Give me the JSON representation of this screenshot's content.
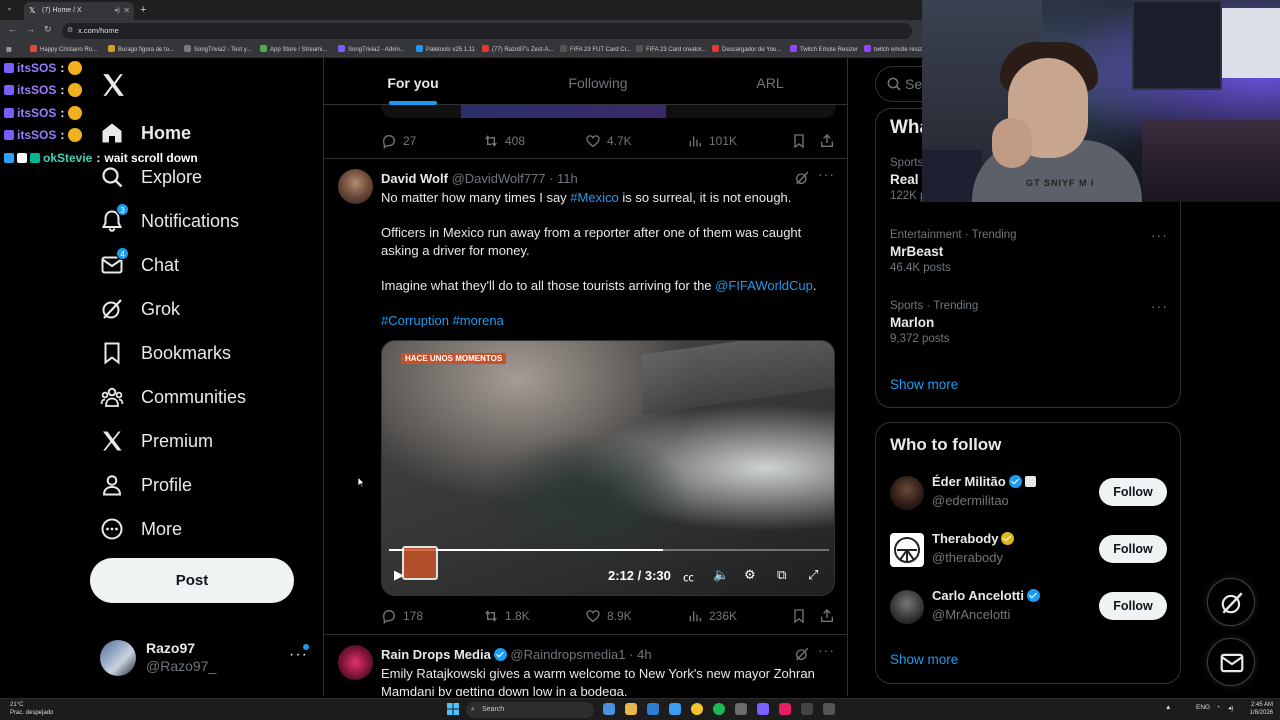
{
  "browser": {
    "tab_title": "(7) Home / X",
    "url": "x.com/home",
    "new_tab": "+",
    "bookmarks": [
      {
        "label": "Happy Cristiano Ro...",
        "color": "#e04a3a"
      },
      {
        "label": "Burago figura de to...",
        "color": "#d8a020"
      },
      {
        "label": "SongTrivia2 - Test y...",
        "color": "#7a7a7a"
      },
      {
        "label": "App Store / Streami...",
        "color": "#4caf50"
      },
      {
        "label": "SongTrivia2 - Advin...",
        "color": "#7a5cff"
      },
      {
        "label": "Paletools v25.1.11",
        "color": "#2196f3"
      },
      {
        "label": "(77) Razo97's Zest-A...",
        "color": "#e53935"
      },
      {
        "label": "FIFA 23 FUT Card Cr...",
        "color": "#555555"
      },
      {
        "label": "FIFA 23 Card creator...",
        "color": "#555555"
      },
      {
        "label": "Descargador de You...",
        "color": "#e53935"
      },
      {
        "label": "Twitch Emote Resizer",
        "color": "#9146ff"
      },
      {
        "label": "twitch emote resiz...",
        "color": "#9146ff"
      }
    ]
  },
  "chat": [
    {
      "user": "itsSOS",
      "msg": ""
    },
    {
      "user": "itsSOS",
      "msg": ""
    },
    {
      "user": "itsSOS",
      "msg": ""
    },
    {
      "user": "itsSOS",
      "msg": ""
    },
    {
      "user": "okStevie",
      "msg": "wait scroll down"
    }
  ],
  "nav": {
    "items": [
      {
        "label": "Home",
        "icon": "home-icon"
      },
      {
        "label": "Explore",
        "icon": "search-icon"
      },
      {
        "label": "Notifications",
        "icon": "bell-icon",
        "badge": "3"
      },
      {
        "label": "Chat",
        "icon": "mail-icon",
        "badge": "4"
      },
      {
        "label": "Grok",
        "icon": "grok-icon"
      },
      {
        "label": "Bookmarks",
        "icon": "bookmark-icon"
      },
      {
        "label": "Communities",
        "icon": "people-icon"
      },
      {
        "label": "Premium",
        "icon": "x-logo-icon"
      },
      {
        "label": "Profile",
        "icon": "person-icon"
      },
      {
        "label": "More",
        "icon": "more-circle-icon"
      }
    ],
    "post_label": "Post"
  },
  "account": {
    "name": "Razo97",
    "handle": "@Razo97_",
    "more": "···"
  },
  "timeline": {
    "tabs": [
      "For you",
      "Following",
      "ARL"
    ],
    "prev_actions": {
      "replies": "27",
      "reposts": "408",
      "likes": "4.7K",
      "views": "101K"
    },
    "tweets": [
      {
        "name": "David Wolf",
        "handle": "@DavidWolf777",
        "time": "11h",
        "p1_pre": "No matter how many times I say ",
        "p1_link": "#Mexico",
        "p1_post": " is so surreal, it is not enough.",
        "p2": "Officers in Mexico run away from a reporter after one of them was caught asking a driver for money.",
        "p3_pre": "Imagine what they'll do to all those tourists arriving for the ",
        "p3_link": "@FIFAWorldCup",
        "p3_post": ".",
        "p4_link1": "#Corruption",
        "p4_link2": "#morena",
        "video": {
          "tag": "HACE UNOS MOMENTOS",
          "time": "2:12 / 3:30",
          "progress": 0.623
        },
        "actions": {
          "replies": "178",
          "reposts": "1.8K",
          "likes": "8.9K",
          "views": "236K"
        }
      },
      {
        "name": "Rain Drops Media",
        "handle": "@Raindropsmedia1",
        "time": "4h",
        "text": "Emily Ratajkowski gives a warm welcome to New York's new mayor Zohran Mamdani by getting down low in a bodega."
      }
    ]
  },
  "right": {
    "search_placeholder": "Sea",
    "trends_title": "Wha",
    "trends": [
      {
        "category": "Sports",
        "name": "Real I",
        "posts": "122K posts"
      },
      {
        "category": "Entertainment · Trending",
        "name": "MrBeast",
        "posts": "46.4K posts"
      },
      {
        "category": "Sports · Trending",
        "name": "Marlon",
        "posts": "9,372 posts"
      }
    ],
    "show_more": "Show more",
    "who_title": "Who to follow",
    "follow": [
      {
        "name": "Éder Militão",
        "handle": "@edermilitao",
        "button": "Follow",
        "badge_color": "#1d9bf0"
      },
      {
        "name": "Therabody",
        "handle": "@therabody",
        "button": "Follow",
        "badge_color": "#e2b719"
      },
      {
        "name": "Carlo Ancelotti",
        "handle": "@MrAncelotti",
        "button": "Follow",
        "badge_color": "#1d9bf0"
      }
    ],
    "who_show_more": "Show more"
  },
  "webcam": {
    "shirt_text": "GT SNIYF M I"
  },
  "taskbar": {
    "weather_temp": "21°C",
    "weather_desc": "Prac. despejado",
    "search": "Search",
    "lang": "ENG",
    "time": "2:45 AM",
    "date": "1/8/2026"
  }
}
